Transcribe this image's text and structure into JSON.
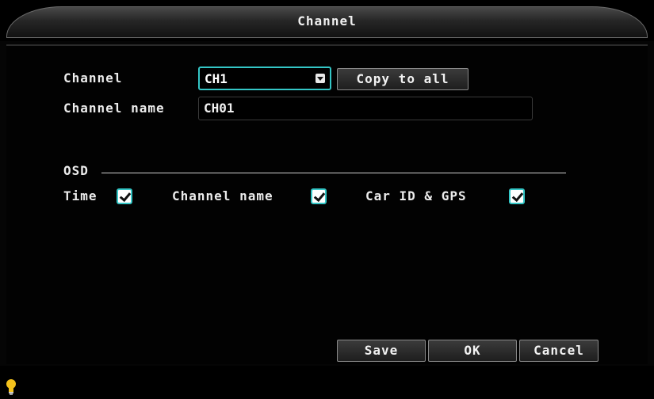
{
  "window": {
    "title": "Channel"
  },
  "channel": {
    "label": "Channel",
    "selected": "CH1",
    "copy_label": "Copy to all"
  },
  "channel_name": {
    "label": "Channel name",
    "value": "CH01"
  },
  "osd": {
    "label": "OSD",
    "options": [
      {
        "label": "Time",
        "checked": true
      },
      {
        "label": "Channel name",
        "checked": true
      },
      {
        "label": "Car ID & GPS",
        "checked": true
      }
    ]
  },
  "buttons": {
    "save": "Save",
    "ok": "OK",
    "cancel": "Cancel"
  },
  "status": {
    "icon": "lightbulb-icon"
  },
  "colors": {
    "accent": "#34c6c6",
    "background": "#000000",
    "hint": "#f4c21c"
  }
}
